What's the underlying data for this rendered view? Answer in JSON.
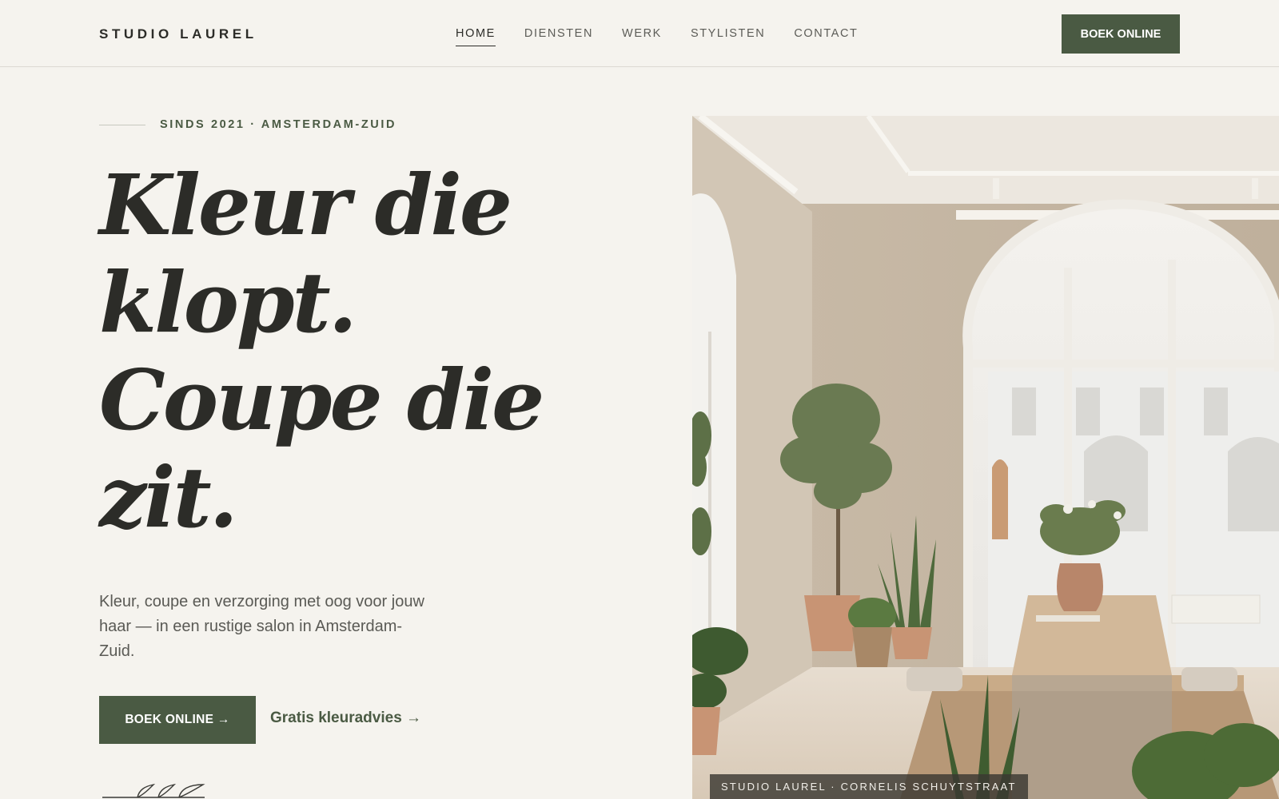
{
  "header": {
    "logo": "STUDIO LAUREL",
    "nav": [
      {
        "label": "HOME",
        "active": true
      },
      {
        "label": "DIENSTEN",
        "active": false
      },
      {
        "label": "WERK",
        "active": false
      },
      {
        "label": "STYLISTEN",
        "active": false
      },
      {
        "label": "CONTACT",
        "active": false
      }
    ],
    "cta_label": "BOEK ONLINE"
  },
  "hero": {
    "eyebrow": "SINDS 2021 · AMSTERDAM-ZUID",
    "headline_lines": [
      "Kleur die",
      "klopt.",
      "Coupe die",
      "zit."
    ],
    "lead": "Kleur, coupe en verzorging met oog voor jouw haar — in een rustige salon in Amsterdam-Zuid.",
    "primary_cta": "BOEK ONLINE  →",
    "secondary_cta": "Gratis kleuradvies →",
    "image_caption": "STUDIO LAUREL · CORNELIS SCHUYTSTRAAT"
  },
  "colors": {
    "background": "#f5f3ee",
    "accent": "#4a5a43",
    "text": "#2c2c28"
  },
  "icons": {
    "sprig": "leaf-sprig-icon"
  }
}
